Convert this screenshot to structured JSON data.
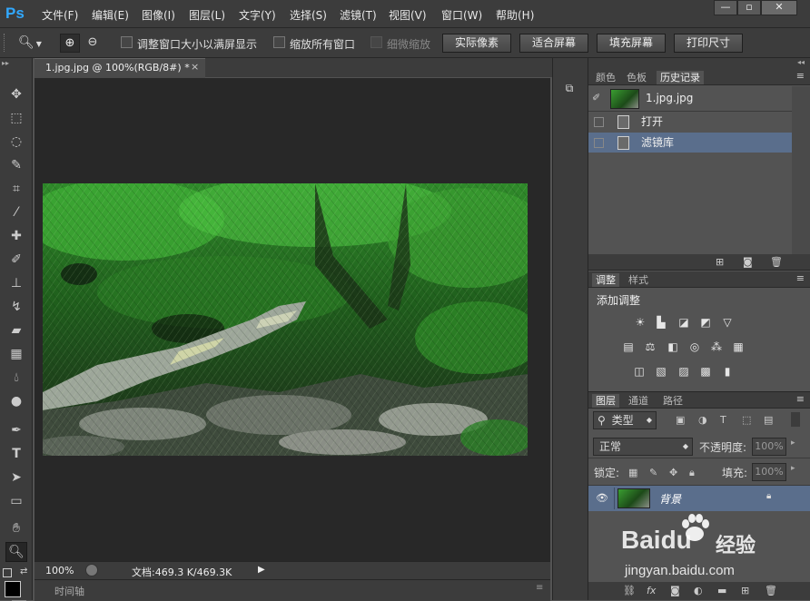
{
  "app": {
    "logo": "Ps"
  },
  "menu": {
    "items": [
      "文件(F)",
      "编辑(E)",
      "图像(I)",
      "图层(L)",
      "文字(Y)",
      "选择(S)",
      "滤镜(T)",
      "视图(V)",
      "窗口(W)",
      "帮助(H)"
    ],
    "window_controls": [
      "minimize-icon",
      "restore-icon",
      "close-icon"
    ]
  },
  "options_bar": {
    "resize_windows_label": "调整窗口大小以满屏显示",
    "zoom_all_label": "缩放所有窗口",
    "scrubby_zoom_label": "细微缩放",
    "actual_pixels": "实际像素",
    "fit_screen": "适合屏幕",
    "fill_screen": "填充屏幕",
    "print_size": "打印尺寸"
  },
  "document": {
    "tab_title": "1.jpg.jpg @ 100%(RGB/8#) *",
    "zoom": "100%",
    "doc_info": "文档:469.3 K/469.3K"
  },
  "timeline": {
    "label": "时间轴"
  },
  "history_panel": {
    "tabs": [
      "颜色",
      "色板",
      "历史记录"
    ],
    "active_tab": "历史记录",
    "snapshot_label": "1.jpg.jpg",
    "states": [
      {
        "label": "打开",
        "selected": false
      },
      {
        "label": "滤镜库",
        "selected": true
      }
    ]
  },
  "adjustments_panel": {
    "tabs": [
      "调整",
      "样式"
    ],
    "title": "添加调整"
  },
  "layers_panel": {
    "tabs": [
      "图层",
      "通道",
      "路径"
    ],
    "filter_kind": "类型",
    "blend_mode": "正常",
    "opacity_label": "不透明度:",
    "opacity_value": "100%",
    "lock_label": "锁定:",
    "fill_label": "填充:",
    "fill_value": "100%",
    "layers": [
      {
        "name": "背景",
        "visible": true,
        "locked": true
      }
    ]
  },
  "watermark": {
    "brand": "Baidu",
    "brand_cn": "经验",
    "url": "jingyan.baidu.com"
  },
  "colors": {
    "menubar_bg": "#3c3c3c",
    "panel_bg": "#535353",
    "canvas_bg": "#282828",
    "selection": "#5a6e8c",
    "ps_blue": "#31a8ff"
  }
}
